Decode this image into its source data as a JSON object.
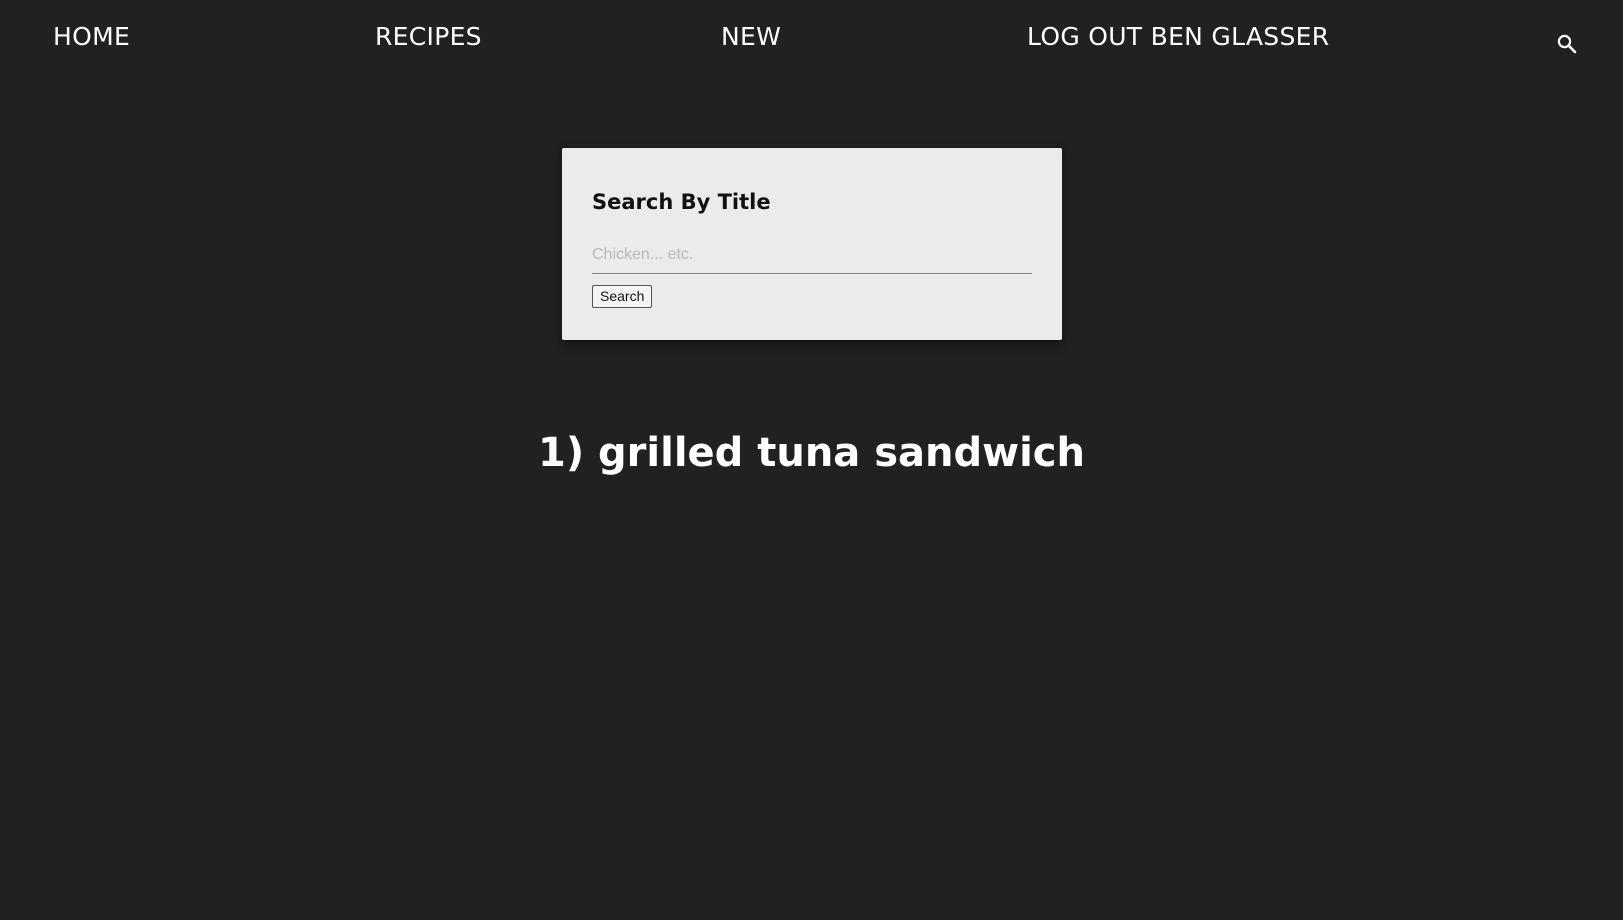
{
  "nav": {
    "home": "HOME",
    "recipes": "RECIPES",
    "new": "NEW",
    "logout": "LOG OUT BEN GLASSER",
    "search_icon": "search-icon"
  },
  "search_card": {
    "title": "Search By Title",
    "placeholder": "Chicken... etc.",
    "value": "",
    "button_label": "Search"
  },
  "results": [
    {
      "label": "1) grilled tuna sandwich"
    }
  ],
  "colors": {
    "background": "#212121",
    "card": "#ebebeb",
    "text_light": "#ffffff",
    "text_dark": "#111111",
    "placeholder": "#b9b9b9"
  }
}
